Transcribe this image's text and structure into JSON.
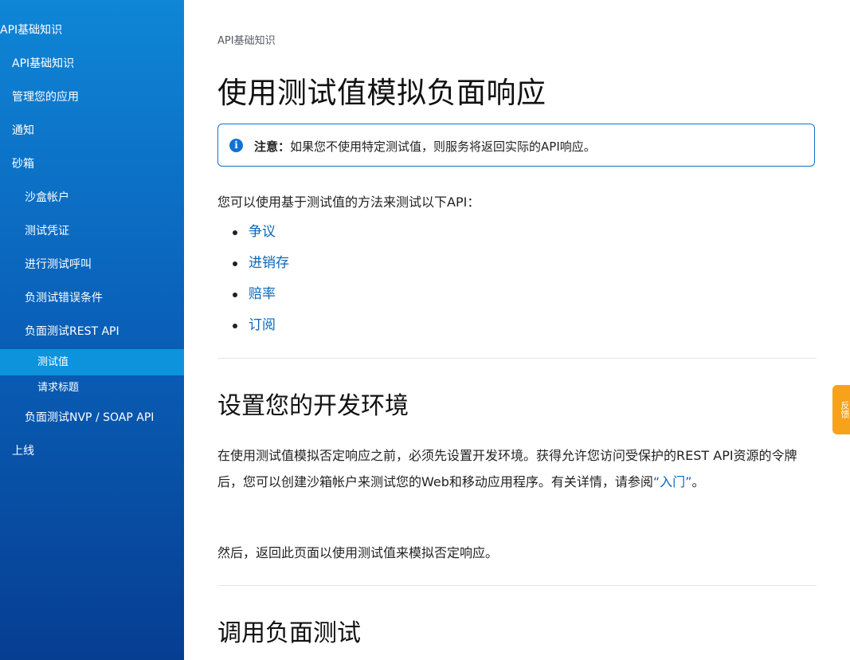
{
  "sidebar": {
    "items": [
      {
        "label": "API基础知识"
      },
      {
        "label": "API基础知识"
      },
      {
        "label": "管理您的应用"
      },
      {
        "label": "通知"
      },
      {
        "label": "砂箱"
      },
      {
        "label": "沙盒帐户"
      },
      {
        "label": "测试凭证"
      },
      {
        "label": "进行测试呼叫"
      },
      {
        "label": "负测试错误条件"
      },
      {
        "label": "负面测试REST API"
      },
      {
        "label": "测试值"
      },
      {
        "label": "请求标题"
      },
      {
        "label": "负面测试NVP / SOAP API"
      },
      {
        "label": "上线"
      }
    ]
  },
  "main": {
    "breadcrumb": "API基础知识",
    "title": "使用测试值模拟负面响应",
    "note": {
      "icon": "info-icon",
      "label": "注意：",
      "text": "如果您不使用特定测试值，则服务将返回实际的API响应。"
    },
    "intro": "您可以使用基于测试值的方法来测试以下API：",
    "api_links": [
      "争议",
      "进销存",
      "赔率",
      "订阅"
    ],
    "section1": {
      "heading": "设置您的开发环境",
      "para1_text": "在使用测试值模拟否定响应之前，必须先设置开发环境。获得允许您访问受保护的REST API资源的令牌后，您可以创建沙箱帐户来测试您的Web和移动应用程序。有关详情，请参阅",
      "para1_link": "“入门”",
      "para1_end": "。",
      "para2": "然后，返回此页面以使用测试值来模拟否定响应。"
    },
    "section2": {
      "heading": "调用负面测试"
    }
  },
  "feedback_tab": {
    "label": "反馈"
  },
  "colors": {
    "sidebar_top": "#0f86d6",
    "sidebar_bottom": "#063e92",
    "link": "#0a67b8",
    "note_border": "#1172c9",
    "feedback": "#f7a21b"
  }
}
